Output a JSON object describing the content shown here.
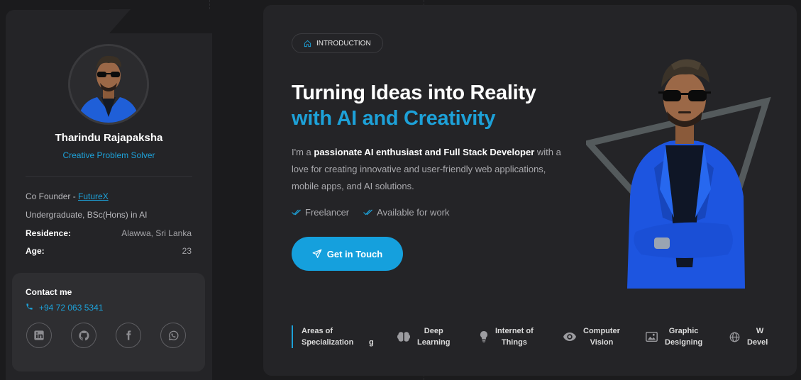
{
  "profile": {
    "name": "Tharindu Rajapaksha",
    "title": "Creative Problem Solver",
    "cofounder_prefix": "Co Founder - ",
    "cofounder_link": "FutureX",
    "education": "Undergraduate, BSc(Hons) in AI",
    "residence_label": "Residence:",
    "residence_value": "Alawwa, Sri Lanka",
    "age_label": "Age:",
    "age_value": "23"
  },
  "contact": {
    "title": "Contact me",
    "phone": "+94 72 063 5341",
    "socials": [
      "linkedin-icon",
      "github-icon",
      "facebook-icon",
      "whatsapp-icon"
    ]
  },
  "hero": {
    "badge": "INTRODUCTION",
    "headline_line1": "Turning Ideas into Reality",
    "headline_line2": "with AI and Creativity",
    "desc_prefix": "I'm a ",
    "desc_bold": "passionate AI enthusiast and Full Stack Developer",
    "desc_rest": " with a love for creating innovative and user-friendly web applications, mobile apps, and AI solutions.",
    "checks": [
      "Freelancer",
      "Available for work"
    ],
    "cta_label": "Get in Touch"
  },
  "areas": {
    "label_line1": "Areas of",
    "label_line2": "Specialization",
    "partial_item": "g",
    "items": [
      {
        "icon": "brain-icon",
        "line1": "Deep",
        "line2": "Learning"
      },
      {
        "icon": "lightbulb-icon",
        "line1": "Internet of",
        "line2": "Things"
      },
      {
        "icon": "eye-icon",
        "line1": "Computer",
        "line2": "Vision"
      },
      {
        "icon": "image-icon",
        "line1": "Graphic",
        "line2": "Designing"
      },
      {
        "icon": "globe-icon",
        "line1": "W",
        "line2": "Develo"
      }
    ]
  },
  "colors": {
    "accent": "#1da1d8",
    "background": "#1b1b1d",
    "card": "#242427"
  }
}
